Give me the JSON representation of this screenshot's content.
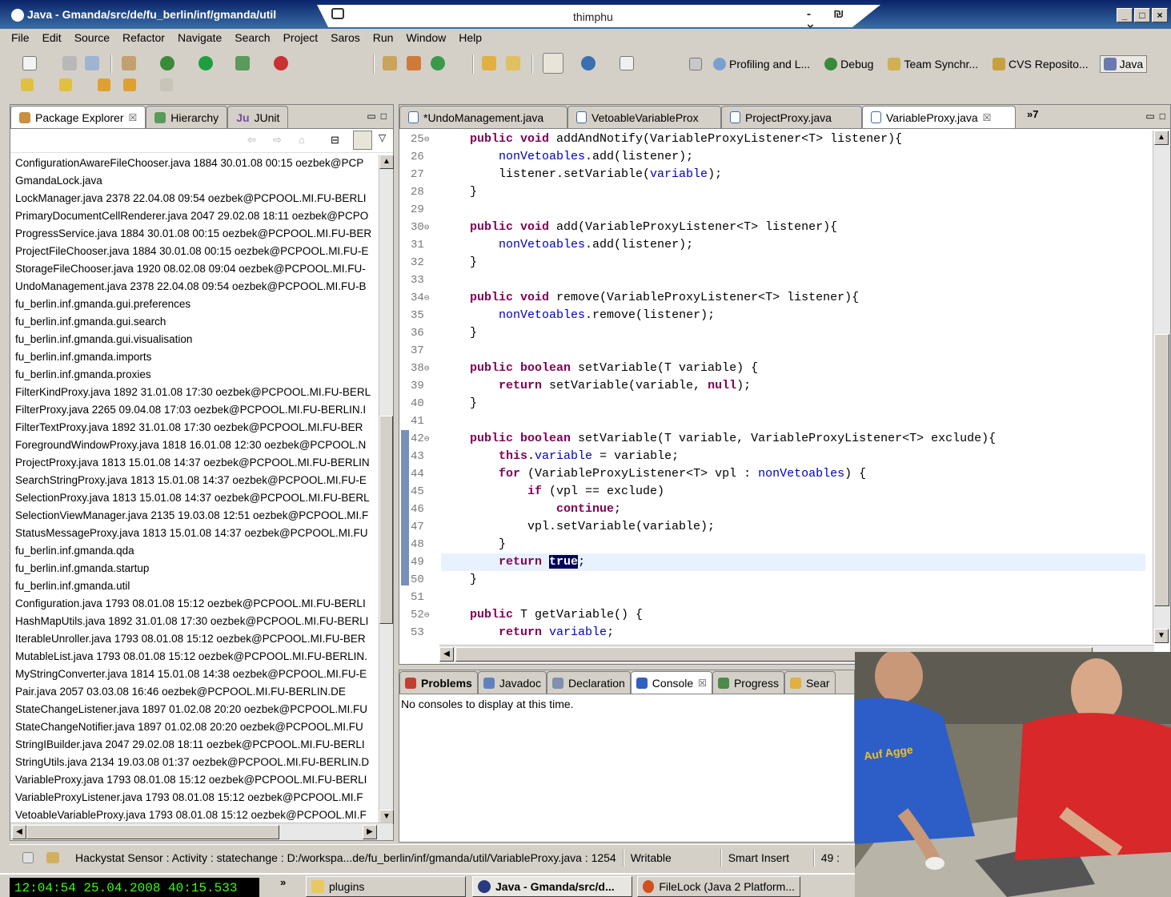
{
  "window": {
    "title": "Java - Gmanda/src/de/fu_berlin/inf/gmanda/util",
    "overlay_title": "thimphu",
    "overlay_controls": "- ₪ ×"
  },
  "menu": [
    "File",
    "Edit",
    "Source",
    "Refactor",
    "Navigate",
    "Search",
    "Project",
    "Saros",
    "Run",
    "Window",
    "Help"
  ],
  "perspectives": [
    {
      "label": "Profiling and L...",
      "icon": "profile-perspective-icon"
    },
    {
      "label": "Debug",
      "icon": "debug-perspective-icon"
    },
    {
      "label": "Team Synchr...",
      "icon": "team-sync-perspective-icon"
    },
    {
      "label": "CVS Reposito...",
      "icon": "cvs-perspective-icon"
    },
    {
      "label": "Java",
      "icon": "java-perspective-icon",
      "active": true
    }
  ],
  "left_panel": {
    "tabs": [
      {
        "label": "Package Explorer",
        "close": "☒",
        "active": true
      },
      {
        "label": "Hierarchy"
      },
      {
        "label": "JUnit",
        "prefix": "Ju"
      }
    ],
    "rows": [
      "ConfigurationAwareFileChooser.java 1884  30.01.08 00:15  oezbek@PCP",
      "GmandaLock.java",
      "LockManager.java 2378  22.04.08 09:54  oezbek@PCPOOL.MI.FU-BERLI",
      "PrimaryDocumentCellRenderer.java 2047  29.02.08 18:11  oezbek@PCPO",
      "ProgressService.java 1884  30.01.08 00:15  oezbek@PCPOOL.MI.FU-BER",
      "ProjectFileChooser.java 1884  30.01.08 00:15  oezbek@PCPOOL.MI.FU-E",
      "StorageFileChooser.java 1920  08.02.08 09:04  oezbek@PCPOOL.MI.FU-",
      "UndoManagement.java 2378  22.04.08 09:54  oezbek@PCPOOL.MI.FU-B",
      "fu_berlin.inf.gmanda.gui.preferences",
      "fu_berlin.inf.gmanda.gui.search",
      "fu_berlin.inf.gmanda.gui.visualisation",
      "fu_berlin.inf.gmanda.imports",
      "fu_berlin.inf.gmanda.proxies",
      "FilterKindProxy.java 1892  31.01.08 17:30  oezbek@PCPOOL.MI.FU-BERL",
      "FilterProxy.java 2265  09.04.08 17:03  oezbek@PCPOOL.MI.FU-BERLIN.I",
      "FilterTextProxy.java 1892  31.01.08 17:30  oezbek@PCPOOL.MI.FU-BER",
      "ForegroundWindowProxy.java 1818  16.01.08 12:30  oezbek@PCPOOL.N",
      "ProjectProxy.java 1813  15.01.08 14:37  oezbek@PCPOOL.MI.FU-BERLIN",
      "SearchStringProxy.java 1813  15.01.08 14:37  oezbek@PCPOOL.MI.FU-E",
      "SelectionProxy.java 1813  15.01.08 14:37  oezbek@PCPOOL.MI.FU-BERL",
      "SelectionViewManager.java 2135  19.03.08 12:51  oezbek@PCPOOL.MI.F",
      "StatusMessageProxy.java 1813  15.01.08 14:37  oezbek@PCPOOL.MI.FU",
      "fu_berlin.inf.gmanda.qda",
      "fu_berlin.inf.gmanda.startup",
      "fu_berlin.inf.gmanda.util",
      "Configuration.java 1793  08.01.08 15:12  oezbek@PCPOOL.MI.FU-BERLI",
      "HashMapUtils.java 1892  31.01.08 17:30  oezbek@PCPOOL.MI.FU-BERLI",
      "IterableUnroller.java 1793  08.01.08 15:12  oezbek@PCPOOL.MI.FU-BER",
      "MutableList.java 1793  08.01.08 15:12  oezbek@PCPOOL.MI.FU-BERLIN.",
      "MyStringConverter.java 1814  15.01.08 14:38  oezbek@PCPOOL.MI.FU-E",
      "Pair.java 2057  03.03.08 16:46  oezbek@PCPOOL.MI.FU-BERLIN.DE",
      "StateChangeListener.java 1897  01.02.08 20:20  oezbek@PCPOOL.MI.FU",
      "StateChangeNotifier.java 1897  01.02.08 20:20  oezbek@PCPOOL.MI.FU",
      "StringIBuilder.java 2047  29.02.08 18:11  oezbek@PCPOOL.MI.FU-BERLI",
      "StringUtils.java 2134  19.03.08 01:37  oezbek@PCPOOL.MI.FU-BERLIN.D",
      "VariableProxy.java 1793  08.01.08 15:12  oezbek@PCPOOL.MI.FU-BERLI",
      "VariableProxyListener.java 1793  08.01.08 15:12  oezbek@PCPOOL.MI.F",
      "VetoableVariableProxy.java 1793  08.01.08 15:12  oezbek@PCPOOL.MI.F"
    ]
  },
  "editor": {
    "tabs": [
      {
        "label": "*UndoManagement.java"
      },
      {
        "label": "VetoableVariableProx"
      },
      {
        "label": "ProjectProxy.java"
      },
      {
        "label": "VariableProxy.java",
        "close": "☒",
        "active": true
      }
    ],
    "overflow": "»7",
    "lines": [
      {
        "n": "25",
        "fold": "⊖",
        "code": [
          [
            "k",
            "    public void"
          ],
          [
            "t",
            " addAndNotify(VariableProxyListener<T> listener){"
          ]
        ]
      },
      {
        "n": "26",
        "code": [
          [
            "t",
            "        "
          ],
          [
            "f",
            "nonVetoables"
          ],
          [
            "t",
            ".add(listener);"
          ]
        ]
      },
      {
        "n": "27",
        "code": [
          [
            "t",
            "        listener.setVariable("
          ],
          [
            "f",
            "variable"
          ],
          [
            "t",
            ");"
          ]
        ]
      },
      {
        "n": "28",
        "code": [
          [
            "t",
            "    }"
          ]
        ]
      },
      {
        "n": "29",
        "code": []
      },
      {
        "n": "30",
        "fold": "⊖",
        "code": [
          [
            "k",
            "    public void"
          ],
          [
            "t",
            " add(VariableProxyListener<T> listener){"
          ]
        ]
      },
      {
        "n": "31",
        "code": [
          [
            "t",
            "        "
          ],
          [
            "f",
            "nonVetoables"
          ],
          [
            "t",
            ".add(listener);"
          ]
        ]
      },
      {
        "n": "32",
        "code": [
          [
            "t",
            "    }"
          ]
        ]
      },
      {
        "n": "33",
        "code": []
      },
      {
        "n": "34",
        "fold": "⊖",
        "code": [
          [
            "k",
            "    public void"
          ],
          [
            "t",
            " remove(VariableProxyListener<T> listener){"
          ]
        ]
      },
      {
        "n": "35",
        "code": [
          [
            "t",
            "        "
          ],
          [
            "f",
            "nonVetoables"
          ],
          [
            "t",
            ".remove(listener);"
          ]
        ]
      },
      {
        "n": "36",
        "code": [
          [
            "t",
            "    }"
          ]
        ]
      },
      {
        "n": "37",
        "code": []
      },
      {
        "n": "38",
        "fold": "⊖",
        "code": [
          [
            "k",
            "    public boolean"
          ],
          [
            "t",
            " setVariable(T variable) {"
          ]
        ]
      },
      {
        "n": "39",
        "code": [
          [
            "k",
            "        return"
          ],
          [
            "t",
            " setVariable(variable, "
          ],
          [
            "k",
            "null"
          ],
          [
            "t",
            ");"
          ]
        ]
      },
      {
        "n": "40",
        "code": [
          [
            "t",
            "    }"
          ]
        ]
      },
      {
        "n": "41",
        "code": []
      },
      {
        "n": "42",
        "fold": "⊖",
        "code": [
          [
            "k",
            "    public boolean"
          ],
          [
            "t",
            " setVariable(T variable, VariableProxyListener<T> exclude){"
          ]
        ]
      },
      {
        "n": "43",
        "code": [
          [
            "k",
            "        this"
          ],
          [
            "t",
            "."
          ],
          [
            "f",
            "variable"
          ],
          [
            "t",
            " = variable;"
          ]
        ]
      },
      {
        "n": "44",
        "code": [
          [
            "k",
            "        for"
          ],
          [
            "t",
            " (VariableProxyListener<T> vpl : "
          ],
          [
            "f",
            "nonVetoables"
          ],
          [
            "t",
            ") {"
          ]
        ]
      },
      {
        "n": "45",
        "code": [
          [
            "k",
            "            if"
          ],
          [
            "t",
            " (vpl == exclude)"
          ]
        ]
      },
      {
        "n": "46",
        "code": [
          [
            "k",
            "                continue"
          ],
          [
            "t",
            ";"
          ]
        ]
      },
      {
        "n": "47",
        "code": [
          [
            "t",
            "            vpl.setVariable(variable);"
          ]
        ]
      },
      {
        "n": "48",
        "code": [
          [
            "t",
            "        }"
          ]
        ]
      },
      {
        "n": "49",
        "cur": true,
        "code": [
          [
            "k",
            "        return"
          ],
          [
            "t",
            " "
          ],
          [
            "s",
            "true"
          ],
          [
            "t",
            ";"
          ]
        ]
      },
      {
        "n": "50",
        "code": [
          [
            "t",
            "    }"
          ]
        ]
      },
      {
        "n": "51",
        "code": []
      },
      {
        "n": "52",
        "fold": "⊖",
        "code": [
          [
            "k",
            "    public"
          ],
          [
            "t",
            " T getVariable() {"
          ]
        ]
      },
      {
        "n": "53",
        "code": [
          [
            "k",
            "        return"
          ],
          [
            "t",
            " "
          ],
          [
            "f",
            "variable"
          ],
          [
            "t",
            ";"
          ]
        ]
      }
    ]
  },
  "console": {
    "tabs": [
      {
        "label": "Problems",
        "bold": true,
        "icon": "problems-icon"
      },
      {
        "label": "Javadoc",
        "icon": "javadoc-icon"
      },
      {
        "label": "Declaration",
        "icon": "declaration-icon"
      },
      {
        "label": "Console",
        "close": "☒",
        "active": true,
        "icon": "console-icon"
      },
      {
        "label": "Progress",
        "icon": "progress-icon"
      },
      {
        "label": "Sear",
        "icon": "search-view-icon"
      }
    ],
    "message": "No consoles to display at this time."
  },
  "status": {
    "sensor": "Hackystat Sensor : Activity : statechange : D:/workspa...de/fu_berlin/inf/gmanda/util/VariableProxy.java : 1254",
    "writable": "Writable",
    "insert_mode": "Smart Insert",
    "position": "49 :"
  },
  "taskbar": {
    "clock": "12:04:54 25.04.2008 40:15.533",
    "chevron": "»",
    "items": [
      {
        "label": "plugins",
        "icon": "folder-icon"
      },
      {
        "label": "Java - Gmanda/src/d...",
        "icon": "eclipse-icon"
      },
      {
        "label": "FileLock (Java 2 Platform...",
        "icon": "browser-icon"
      }
    ]
  },
  "video": {
    "shirt_text": "Auf Agge"
  },
  "colors": {
    "keyword": "#7f0055",
    "field": "#0000c0",
    "selection": "#00005a",
    "current_line": "#e8f2fe",
    "title_bar": "#0a246a"
  }
}
